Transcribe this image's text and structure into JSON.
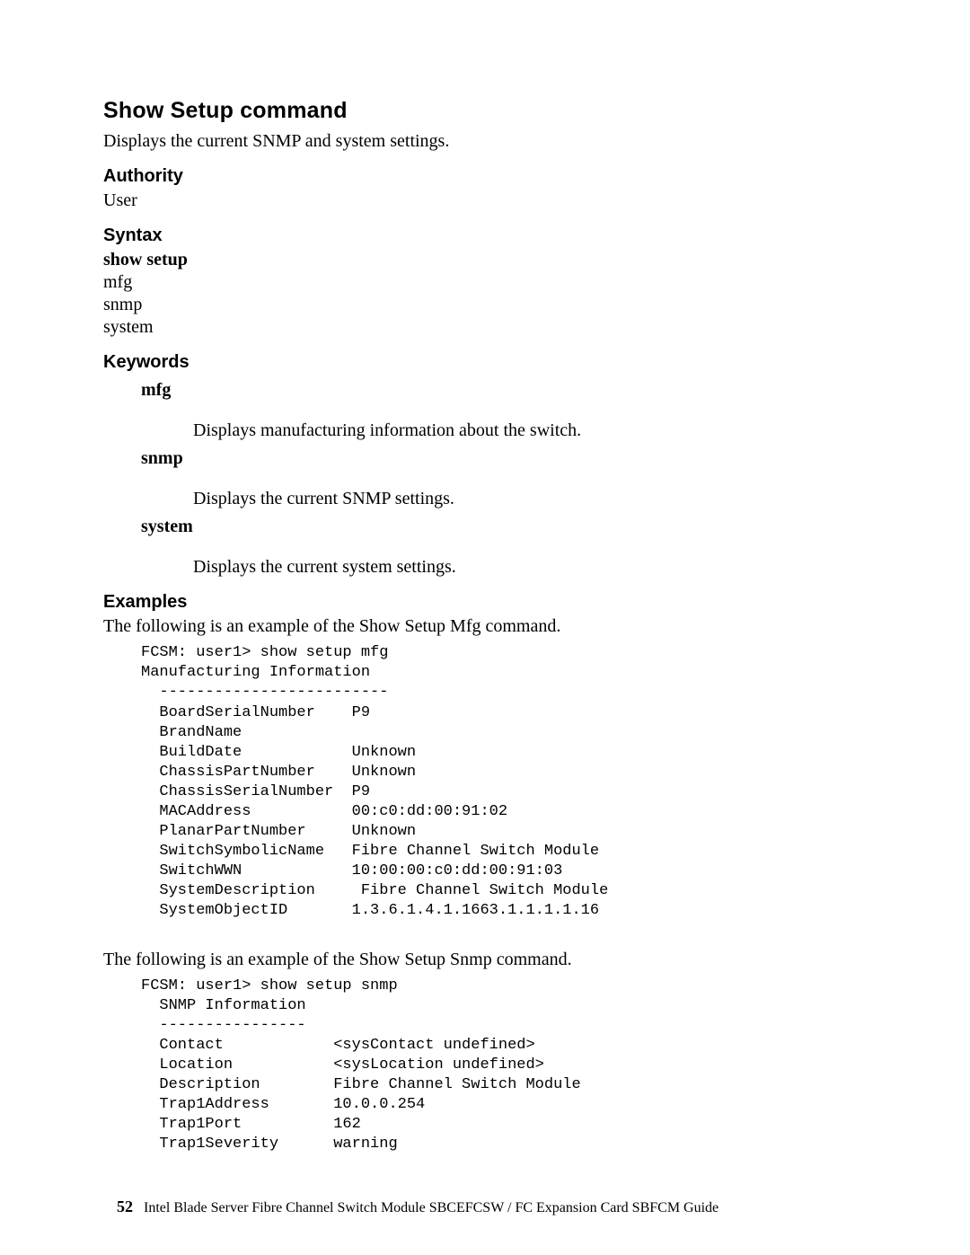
{
  "title": "Show Setup command",
  "intro": "Displays the current SNMP and system settings.",
  "authority": {
    "heading": "Authority",
    "value": "User"
  },
  "syntax": {
    "heading": "Syntax",
    "command": "show setup",
    "args": [
      "mfg",
      "snmp",
      "system"
    ]
  },
  "keywords": {
    "heading": "Keywords",
    "items": [
      {
        "term": "mfg",
        "desc": "Displays manufacturing information about the switch."
      },
      {
        "term": "snmp",
        "desc": "Displays the current SNMP settings."
      },
      {
        "term": "system",
        "desc": "Displays the current system settings."
      }
    ]
  },
  "examples": {
    "heading": "Examples",
    "intro1": "The following is an example of the Show Setup Mfg command.",
    "code1": "FCSM: user1> show setup mfg\nManufacturing Information\n  -------------------------\n  BoardSerialNumber    P9\n  BrandName\n  BuildDate            Unknown\n  ChassisPartNumber    Unknown\n  ChassisSerialNumber  P9\n  MACAddress           00:c0:dd:00:91:02\n  PlanarPartNumber     Unknown\n  SwitchSymbolicName   Fibre Channel Switch Module\n  SwitchWWN            10:00:00:c0:dd:00:91:03\n  SystemDescription     Fibre Channel Switch Module\n  SystemObjectID       1.3.6.1.4.1.1663.1.1.1.1.16",
    "intro2": "The following is an example of the Show Setup Snmp command.",
    "code2": "FCSM: user1> show setup snmp\n  SNMP Information\n  ----------------\n  Contact            <sysContact undefined>\n  Location           <sysLocation undefined>\n  Description        Fibre Channel Switch Module\n  Trap1Address       10.0.0.254\n  Trap1Port          162\n  Trap1Severity      warning"
  },
  "footer": {
    "pagenum": "52",
    "text": "Intel Blade Server Fibre Channel Switch Module SBCEFCSW / FC Expansion Card SBFCM Guide"
  }
}
